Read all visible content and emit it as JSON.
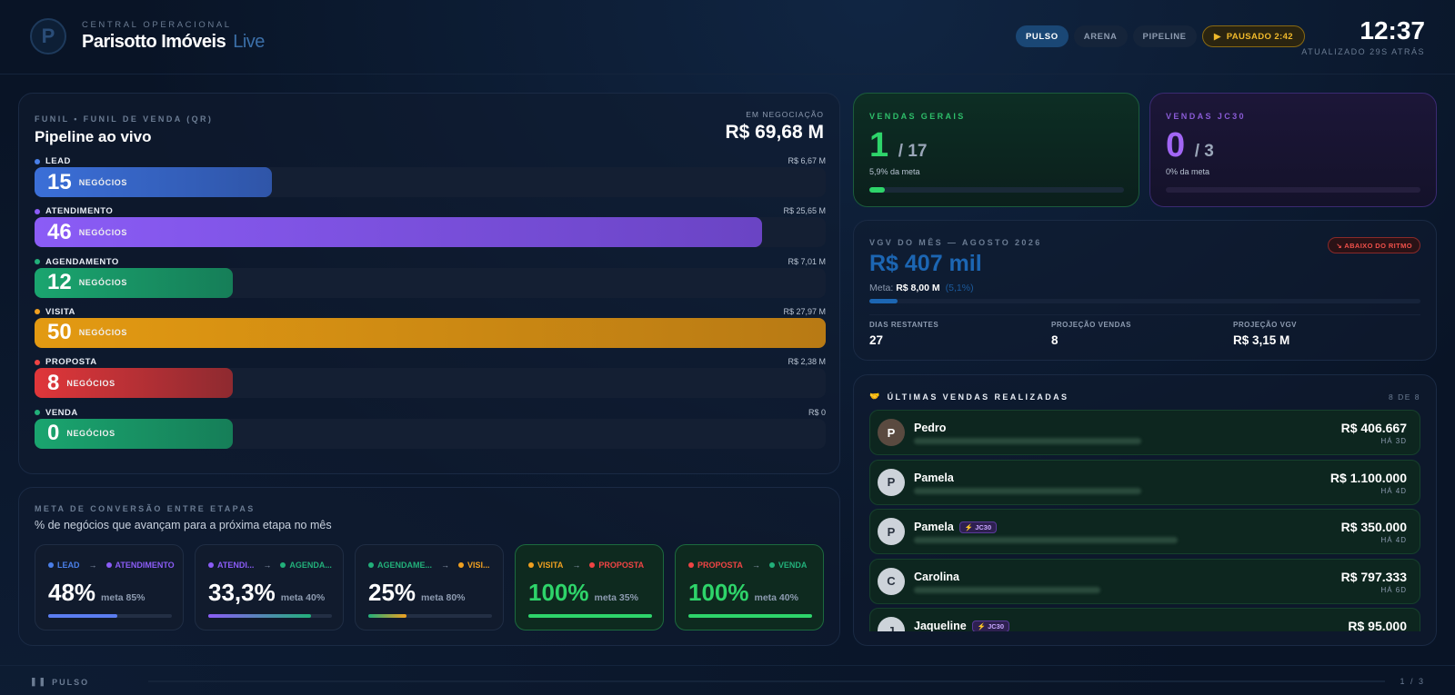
{
  "header": {
    "kicker": "CENTRAL OPERACIONAL",
    "title": "Parisotto Imóveis",
    "live": "Live",
    "logo_letter": "P",
    "tabs": [
      {
        "label": "PULSO",
        "active": true
      },
      {
        "label": "ARENA",
        "active": false
      },
      {
        "label": "PIPELINE",
        "active": false
      }
    ],
    "pause_label": "PAUSADO 2:42",
    "clock": "12:37",
    "updated": "ATUALIZADO 29S ATRÁS"
  },
  "funnel": {
    "kicker": "FUNIL • FUNIL DE VENDA (QR)",
    "title": "Pipeline ao vivo",
    "negociacao_label": "EM NEGOCIAÇÃO",
    "negociacao_value": "R$ 69,68 M",
    "unit": "NEGÓCIOS",
    "stages": [
      {
        "name": "LEAD",
        "value": "R$ 6,67 M",
        "count": "15",
        "fill": 0.3,
        "dot": "#4a7fe8",
        "grad": "linear-gradient(90deg,#3b6fd8,#2f55a8)"
      },
      {
        "name": "ATENDIMENTO",
        "value": "R$ 25,65 M",
        "count": "46",
        "fill": 0.92,
        "dot": "#8b5cf6",
        "grad": "linear-gradient(90deg,#8b5cf6,#6a44c4)"
      },
      {
        "name": "AGENDAMENTO",
        "value": "R$ 7,01 M",
        "count": "12",
        "fill": 0.25,
        "dot": "#22b07a",
        "grad": "linear-gradient(90deg,#1aa56f,#167e58)"
      },
      {
        "name": "VISITA",
        "value": "R$ 27,97 M",
        "count": "50",
        "fill": 1.0,
        "dot": "#f0a020",
        "grad": "linear-gradient(90deg,#e39a12,#b87a14)"
      },
      {
        "name": "PROPOSTA",
        "value": "R$ 2,38 M",
        "count": "8",
        "fill": 0.25,
        "dot": "#ef4444",
        "grad": "linear-gradient(90deg,#e0363a,#8e2a30)"
      },
      {
        "name": "VENDA",
        "value": "R$ 0",
        "count": "0",
        "fill": 0.25,
        "dot": "#22b07a",
        "grad": "linear-gradient(90deg,#1aa56f,#167e58)"
      }
    ]
  },
  "conversion": {
    "kicker": "META DE CONVERSÃO ENTRE ETAPAS",
    "subtitle": "% de negócios que avançam para a próxima etapa no mês",
    "items": [
      {
        "from": "LEAD",
        "to": "ATENDIMENTO",
        "from_color": "#4a7fe8",
        "to_color": "#8b5cf6",
        "pct": "48%",
        "meta": "meta 85%",
        "fill": 0.56,
        "bar": "#5b7df0",
        "good": false
      },
      {
        "from": "ATENDI...",
        "to": "AGENDA...",
        "from_color": "#8b5cf6",
        "to_color": "#22b07a",
        "pct": "33,3%",
        "meta": "meta 40%",
        "fill": 0.83,
        "bar": "linear-gradient(90deg,#8b5cf6,#22b07a)",
        "good": false
      },
      {
        "from": "AGENDAME...",
        "to": "VISI...",
        "from_color": "#22b07a",
        "to_color": "#f0a020",
        "pct": "25%",
        "meta": "meta 80%",
        "fill": 0.31,
        "bar": "linear-gradient(90deg,#22b07a,#f0a020)",
        "good": false
      },
      {
        "from": "VISITA",
        "to": "PROPOSTA",
        "from_color": "#f0a020",
        "to_color": "#ef4444",
        "pct": "100%",
        "meta": "meta 35%",
        "fill": 1.0,
        "bar": "#2ed46a",
        "good": true
      },
      {
        "from": "PROPOSTA",
        "to": "VENDA",
        "from_color": "#ef4444",
        "to_color": "#22b07a",
        "pct": "100%",
        "meta": "meta 40%",
        "fill": 1.0,
        "bar": "#2ed46a",
        "good": true
      }
    ]
  },
  "vendas_gerais": {
    "kicker": "VENDAS GERAIS",
    "value": "1",
    "of": "/ 17",
    "meta": "5,9% da meta",
    "color": "#2ed46a",
    "fill": 0.059
  },
  "vendas_jc30": {
    "kicker": "VENDAS JC30",
    "value": "0",
    "of": "/ 3",
    "meta": "0% da meta",
    "color": "#a266f5",
    "fill": 0.0
  },
  "vgv": {
    "kicker": "VGV DO MÊS — AGOSTO 2026",
    "value": "R$ 407 mil",
    "meta_label": "Meta:",
    "meta_value": "R$ 8,00 M",
    "meta_pct": "(5,1%)",
    "badge": "↘ ABAIXO DO RITMO",
    "fill": 0.051,
    "stats": [
      {
        "label": "DIAS RESTANTES",
        "value": "27"
      },
      {
        "label": "PROJEÇÃO VENDAS",
        "value": "8"
      },
      {
        "label": "PROJEÇÃO VGV",
        "value": "R$ 3,15 M"
      }
    ]
  },
  "ultimas": {
    "kicker": "ÚLTIMAS VENDAS REALIZADAS",
    "icon": "handshake-icon",
    "count": "8 DE 8",
    "sales": [
      {
        "name": "Pedro",
        "amount": "R$ 406.667",
        "ago": "HÁ 3D",
        "jc30": false,
        "initial": "P",
        "dark": true
      },
      {
        "name": "Pamela",
        "amount": "R$ 1.100.000",
        "ago": "HÁ 4D",
        "jc30": false,
        "initial": "P",
        "dark": false
      },
      {
        "name": "Pamela",
        "amount": "R$ 350.000",
        "ago": "HÁ 4D",
        "jc30": true,
        "initial": "P",
        "dark": false
      },
      {
        "name": "Carolina",
        "amount": "R$ 797.333",
        "ago": "HÁ 6D",
        "jc30": false,
        "initial": "C",
        "dark": false
      },
      {
        "name": "Jaqueline",
        "amount": "R$ 95.000",
        "ago": "",
        "jc30": true,
        "initial": "J",
        "dark": false
      }
    ],
    "jc30_label": "⚡ JC30"
  },
  "footer": {
    "label": "PULSO",
    "page": "1 / 3"
  }
}
